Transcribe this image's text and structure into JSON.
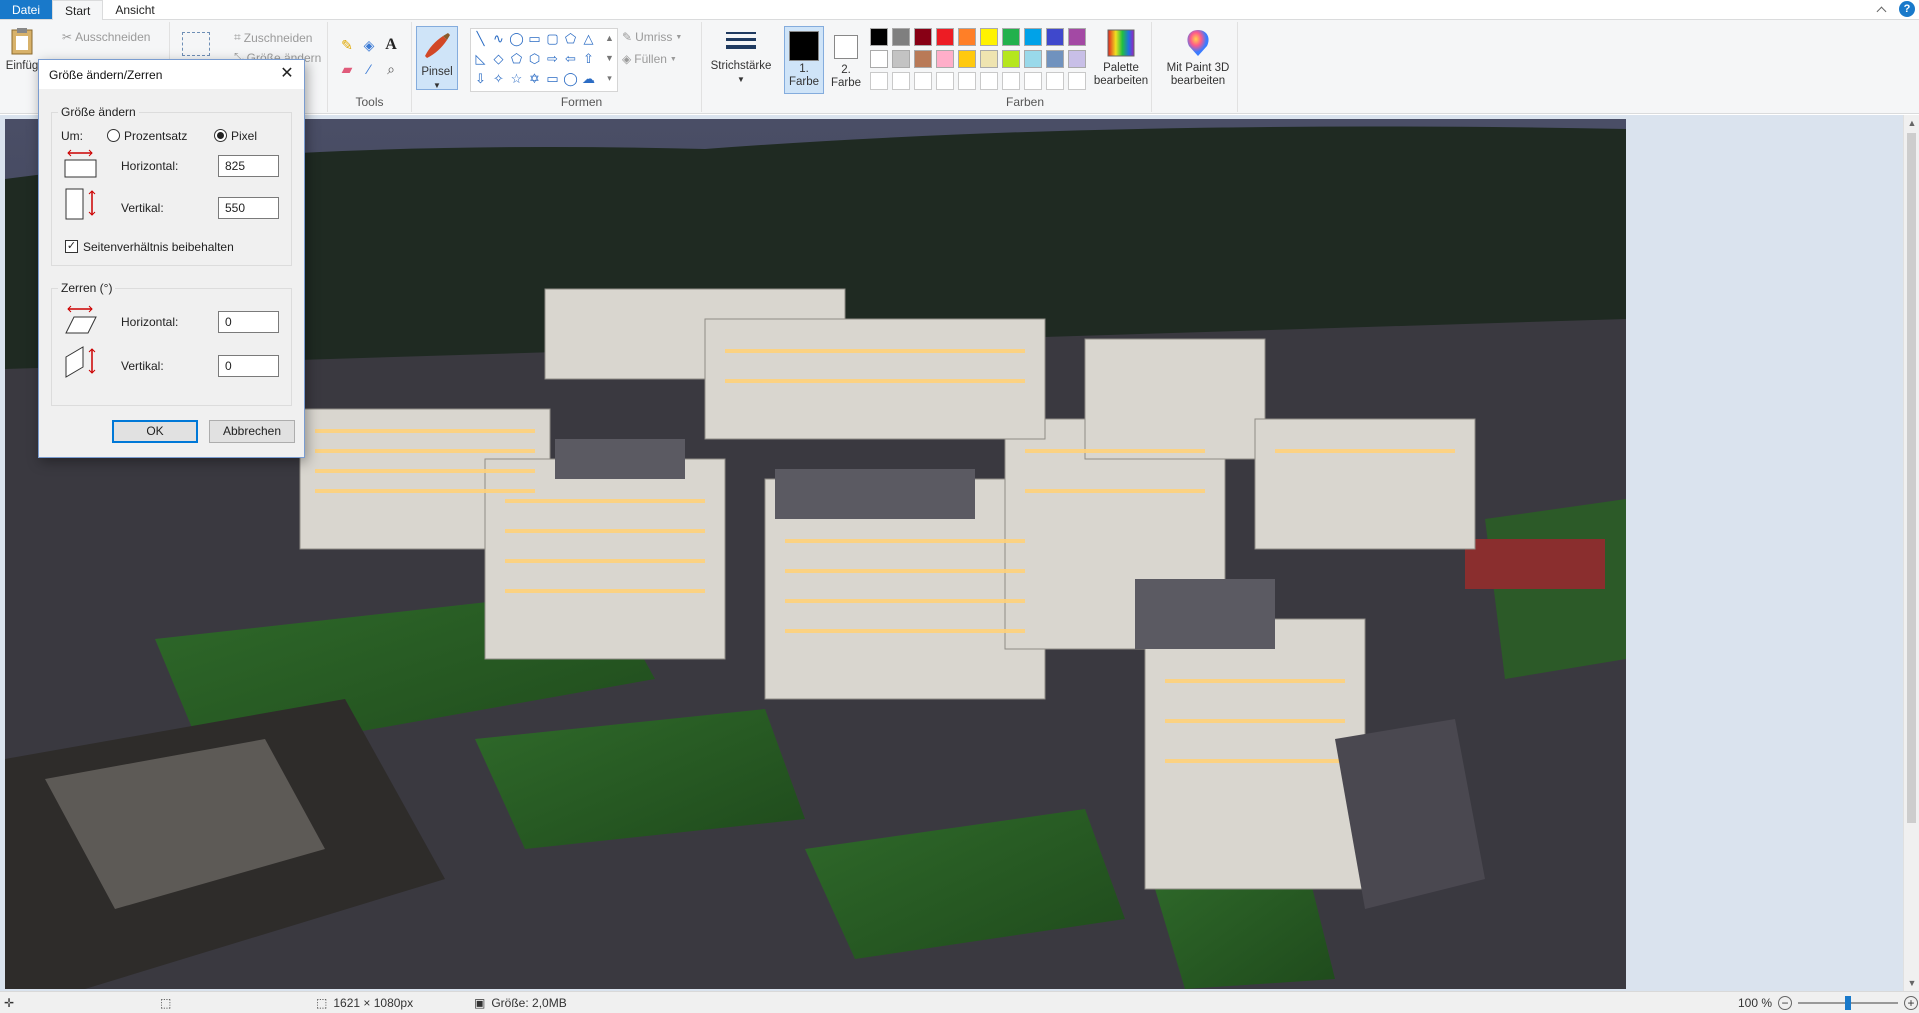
{
  "tabs": {
    "file": "Datei",
    "start": "Start",
    "view": "Ansicht"
  },
  "ribbon": {
    "clipboard": {
      "paste": "Einfüg",
      "cut": "Ausschneiden"
    },
    "image": {
      "crop": "Zuschneiden",
      "resize": "Größe ändern"
    },
    "tools": {
      "label": "Tools"
    },
    "brush": {
      "label": "Pinsel"
    },
    "shapes": {
      "label": "Formen",
      "outline": "Umriss",
      "fill": "Füllen"
    },
    "stroke": {
      "label": "Strichstärke"
    },
    "color1": {
      "line1": "1.",
      "line2": "Farbe"
    },
    "color2": {
      "line1": "2.",
      "line2": "Farbe"
    },
    "colors": {
      "label": "Farben",
      "row1": [
        "#000000",
        "#7f7f7f",
        "#880015",
        "#ed1c24",
        "#ff7f27",
        "#fff200",
        "#22b14c",
        "#00a2e8",
        "#3f48cc",
        "#a349a4"
      ],
      "row2": [
        "#ffffff",
        "#c3c3c3",
        "#b97a57",
        "#ffaec9",
        "#ffc90e",
        "#efe4b0",
        "#b5e61d",
        "#99d9ea",
        "#7092be",
        "#c8bfe7"
      ]
    },
    "edit_palette": {
      "line1": "Palette",
      "line2": "bearbeiten"
    },
    "paint3d": {
      "line1": "Mit Paint 3D",
      "line2": "bearbeiten"
    }
  },
  "dialog": {
    "title": "Größe ändern/Zerren",
    "resize": {
      "legend": "Größe ändern",
      "by_label": "Um:",
      "percent": "Prozentsatz",
      "pixel": "Pixel",
      "selected": "pixel",
      "horizontal_label": "Horizontal:",
      "horizontal_value": "825",
      "vertical_label": "Vertikal:",
      "vertical_value": "550",
      "keep_ratio": "Seitenverhältnis beibehalten",
      "keep_ratio_checked": true
    },
    "skew": {
      "legend": "Zerren (°)",
      "horizontal_label": "Horizontal:",
      "horizontal_value": "0",
      "vertical_label": "Vertikal:",
      "vertical_value": "0"
    },
    "ok": "OK",
    "cancel": "Abbrechen"
  },
  "status": {
    "dimensions": "1621 × 1080px",
    "size": "Größe: 2,0MB",
    "zoom": "100 %",
    "zoom_level": 0.5
  }
}
